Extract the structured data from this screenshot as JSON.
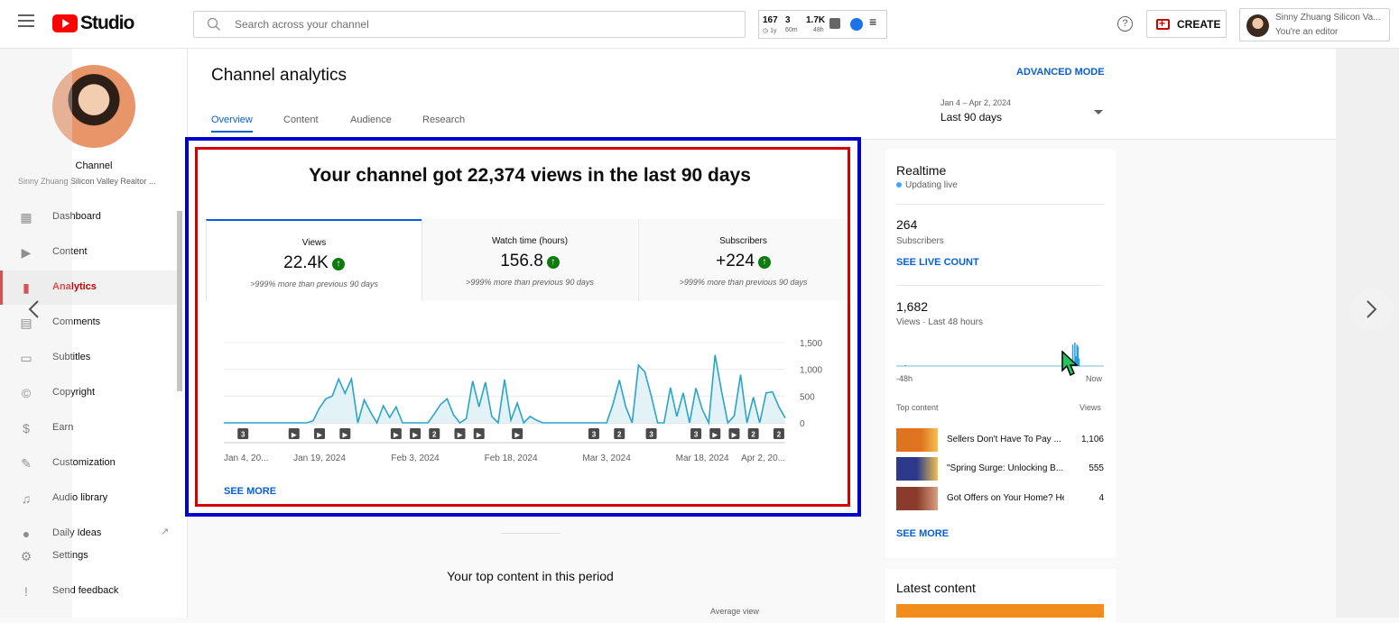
{
  "topbar": {
    "logo_text": "Studio",
    "search_placeholder": "Search across your channel",
    "ext": [
      {
        "num": "167",
        "sub": "1y",
        "color": "#e6a800"
      },
      {
        "num": "3",
        "sub": "60m",
        "color": "#2a7fd4"
      },
      {
        "num": "1.7K",
        "sub": "48h",
        "color": "#2a7fd4"
      }
    ],
    "create_label": "CREATE",
    "account_name": "Sinny Zhuang Silicon Va...",
    "account_role": "You're an editor"
  },
  "sidebar": {
    "channel_label": "Channel",
    "channel_sub": "Sinny Zhuang Silicon Valley Realtor ...",
    "items": [
      {
        "label": "Dashboard",
        "icon": "dashboard-icon"
      },
      {
        "label": "Content",
        "icon": "content-icon"
      },
      {
        "label": "Analytics",
        "icon": "analytics-icon",
        "active": true
      },
      {
        "label": "Comments",
        "icon": "comments-icon"
      },
      {
        "label": "Subtitles",
        "icon": "subtitles-icon"
      },
      {
        "label": "Copyright",
        "icon": "copyright-icon"
      },
      {
        "label": "Earn",
        "icon": "earn-icon"
      },
      {
        "label": "Customization",
        "icon": "customization-icon"
      },
      {
        "label": "Audio library",
        "icon": "audio-library-icon"
      },
      {
        "label": "Daily Ideas",
        "icon": "daily-ideas-icon"
      },
      {
        "label": "Settings",
        "icon": "settings-icon"
      },
      {
        "label": "Send feedback",
        "icon": "feedback-icon"
      }
    ]
  },
  "header": {
    "title": "Channel analytics",
    "advanced_mode": "ADVANCED MODE",
    "tabs": [
      "Overview",
      "Content",
      "Audience",
      "Research"
    ],
    "date_range": "Jan 4 – Apr 2, 2024",
    "date_label": "Last 90 days"
  },
  "overview": {
    "headline": "Your channel got 22,374 views in the last 90 days",
    "metrics": [
      {
        "title": "Views",
        "value": "22.4K",
        "sub": ">999% more than previous 90 days"
      },
      {
        "title": "Watch time (hours)",
        "value": "156.8",
        "sub": ">999% more than previous 90 days"
      },
      {
        "title": "Subscribers",
        "value": "+224",
        "sub": ">999% more than previous 90 days"
      }
    ],
    "see_more": "SEE MORE"
  },
  "chart_data": {
    "type": "area",
    "series": [
      {
        "values": [
          0,
          0,
          0,
          0,
          0,
          0,
          0,
          0,
          0,
          0,
          0,
          0,
          0,
          0,
          40,
          280,
          450,
          500,
          820,
          550,
          820,
          0,
          430,
          200,
          0,
          320,
          100,
          300,
          0,
          0,
          0,
          0,
          0,
          170,
          350,
          450,
          150,
          0,
          80,
          780,
          300,
          760,
          120,
          0,
          810,
          50,
          370,
          0,
          120,
          50,
          0,
          0,
          0,
          0,
          0,
          0,
          0,
          0,
          0,
          0,
          0,
          350,
          800,
          300,
          0,
          1080,
          950,
          500,
          0,
          0,
          660,
          120,
          560,
          0,
          650,
          250,
          0,
          1270,
          600,
          0,
          130,
          900,
          0,
          480,
          0,
          560,
          580,
          300,
          90
        ]
      }
    ],
    "x_tick_labels": [
      "Jan 4, 20...",
      "Jan 19, 2024",
      "Feb 3, 2024",
      "Feb 18, 2024",
      "Mar 3, 2024",
      "Mar 18, 2024",
      "Apr 2, 20..."
    ],
    "y_tick_labels": [
      "1,500",
      "1,000",
      "500",
      "0"
    ],
    "ylim": [
      0,
      1500
    ],
    "grid": true,
    "markers": [
      {
        "day": 3,
        "label": "3"
      },
      {
        "day": 11,
        "label": "▶"
      },
      {
        "day": 15,
        "label": "▶"
      },
      {
        "day": 19,
        "label": "▶"
      },
      {
        "day": 27,
        "label": "▶"
      },
      {
        "day": 30,
        "label": "▶"
      },
      {
        "day": 33,
        "label": "2"
      },
      {
        "day": 37,
        "label": "▶"
      },
      {
        "day": 40,
        "label": "▶"
      },
      {
        "day": 46,
        "label": "▶"
      },
      {
        "day": 58,
        "label": "3"
      },
      {
        "day": 62,
        "label": "2"
      },
      {
        "day": 67,
        "label": "3"
      },
      {
        "day": 74,
        "label": "3"
      },
      {
        "day": 77,
        "label": "▶"
      },
      {
        "day": 80,
        "label": "▶"
      },
      {
        "day": 83,
        "label": "2"
      },
      {
        "day": 87,
        "label": "2"
      }
    ],
    "color": "#2aa4c7"
  },
  "realtime": {
    "title": "Realtime",
    "status": "Updating live",
    "subs_value": "264",
    "subs_label": "Subscribers",
    "live_link": "SEE LIVE COUNT",
    "views_value": "1,682",
    "views_label": "Views · Last 48 hours",
    "axis_left": "-48h",
    "axis_right": "Now",
    "bars": [
      0,
      0,
      0,
      0,
      0,
      0,
      0,
      0,
      1,
      0,
      0,
      0,
      0,
      0,
      0,
      0,
      0,
      0,
      0,
      0,
      0,
      0,
      0,
      0,
      0,
      0,
      0,
      0,
      0,
      0,
      0,
      0,
      0,
      0,
      0,
      0,
      0,
      0,
      0,
      0,
      0,
      0,
      0,
      0,
      0,
      0,
      0,
      0,
      0,
      0,
      0,
      0,
      0,
      0,
      0,
      0,
      0,
      0,
      0,
      0,
      0,
      0,
      0,
      0,
      0,
      0,
      0,
      0,
      0,
      0,
      0,
      0,
      0,
      0,
      0,
      0,
      0,
      0,
      0,
      0,
      0,
      0,
      0,
      0,
      0,
      0,
      0,
      0,
      0,
      0,
      0,
      0,
      0,
      0,
      0,
      0,
      0,
      0,
      0,
      0,
      0,
      0,
      0,
      0,
      0,
      0,
      0,
      0,
      0,
      0,
      0,
      0,
      0,
      0,
      0,
      0,
      0,
      0,
      0,
      0,
      0,
      0,
      0,
      0,
      0,
      0,
      0,
      0,
      0,
      0,
      0,
      0,
      0,
      0,
      0,
      0,
      0,
      0,
      0,
      0,
      0,
      0,
      0,
      0,
      0,
      0,
      0,
      0,
      0,
      0,
      0,
      0,
      0,
      0,
      0,
      0,
      0,
      0,
      0,
      0,
      0,
      0,
      0,
      0,
      0,
      0,
      22,
      0,
      24,
      10,
      22,
      20,
      8,
      0,
      0,
      0,
      0,
      0,
      0,
      0,
      0,
      0,
      0,
      0,
      0,
      0,
      0,
      0,
      0,
      0,
      0,
      0,
      0,
      0,
      0,
      0
    ],
    "top_content_label": "Top content",
    "views_col_label": "Views",
    "top": [
      {
        "title": "Sellers Don't Have To Pay ...",
        "views": "1,106"
      },
      {
        "title": "\"Spring Surge: Unlocking B...",
        "views": "555"
      },
      {
        "title": "Got Offers on Your Home? He...",
        "views": "4"
      }
    ],
    "see_more": "SEE MORE"
  },
  "latest": {
    "title": "Latest content"
  },
  "bottom": {
    "top_content_title": "Your top content in this period",
    "avg_view": "Average view"
  }
}
